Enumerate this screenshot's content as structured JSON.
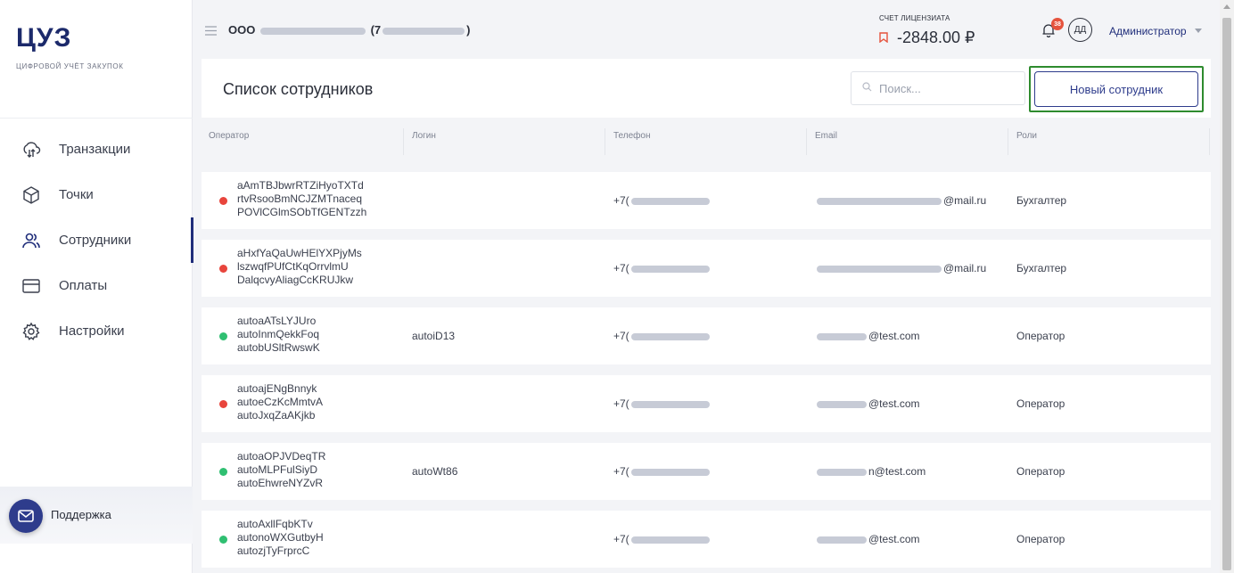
{
  "app": {
    "logo": "ЦУЗ",
    "logo_subtitle": "ЦИФРОВОЙ УЧЁТ ЗАКУПОК"
  },
  "sidebar": {
    "items": [
      {
        "label": "Транзакции",
        "icon": "transactions-icon",
        "active": false
      },
      {
        "label": "Точки",
        "icon": "box-icon",
        "active": false
      },
      {
        "label": "Сотрудники",
        "icon": "users-icon",
        "active": true
      },
      {
        "label": "Оплаты",
        "icon": "card-icon",
        "active": false
      },
      {
        "label": "Настройки",
        "icon": "gear-icon",
        "active": false
      }
    ],
    "support_label": "Поддержка"
  },
  "header": {
    "org_prefix": "ООО",
    "org_suffix_open": "(7",
    "org_suffix_close": ")",
    "account_caption": "СЧЕТ ЛИЦЕНЗИАТА",
    "account_value": "-2848.00 ₽",
    "notification_count": "38",
    "avatar_initials": "ДД",
    "user_role": "Администратор"
  },
  "page": {
    "title": "Список сотрудников",
    "search_placeholder": "Поиск...",
    "new_button_label": "Новый сотрудник"
  },
  "table": {
    "columns": [
      "Оператор",
      "Логин",
      "Телефон",
      "Email",
      "Роли"
    ],
    "rows": [
      {
        "status": "red",
        "operator": [
          "aAmTBJbwrRTZiHyoTXTd",
          "rtvRsooBmNCJZMTnaceq",
          "POVlCGlmSObTfGENTzzh"
        ],
        "login": "",
        "phone": "+7(",
        "email_suffix": "@mail.ru",
        "role": "Бухгалтер"
      },
      {
        "status": "red",
        "operator": [
          "aHxfYaQaUwHElYXPjyMs",
          "lszwqfPUfCtKqOrrvlmU",
          "DalqcvyAliagCcKRUJkw"
        ],
        "login": "",
        "phone": "+7(",
        "email_suffix": "@mail.ru",
        "role": "Бухгалтер"
      },
      {
        "status": "green",
        "operator": [
          "autoaATsLYJUro",
          "autoInmQekkFoq",
          "autobUSltRwswK"
        ],
        "login": "autoiD13",
        "phone": "+7(",
        "email_suffix": "@test.com",
        "role": "Оператор"
      },
      {
        "status": "red",
        "operator": [
          "autoajENgBnnyk",
          "autoeCzKcMmtvA",
          "autoJxqZaAKjkb"
        ],
        "login": "",
        "phone": "+7(",
        "email_suffix": "@test.com",
        "role": "Оператор"
      },
      {
        "status": "green",
        "operator": [
          "autoaOPJVDeqTR",
          "autoMLPFulSiyD",
          "autoEhwreNYZvR"
        ],
        "login": "autoWt86",
        "phone": "+7(",
        "email_suffix": "n@test.com",
        "role": "Оператор"
      },
      {
        "status": "green",
        "operator": [
          "autoAxllFqbKTv",
          "autonoWXGutbyH",
          "autozjTyFrprcC"
        ],
        "login": "",
        "phone": "+7(",
        "email_suffix": "@test.com",
        "role": "Оператор"
      }
    ]
  },
  "colors": {
    "brand": "#1c2a6b",
    "accent": "#2e3c8c",
    "red": "#e8453c",
    "green": "#2fbf71",
    "highlight": "#2e8b2e"
  }
}
